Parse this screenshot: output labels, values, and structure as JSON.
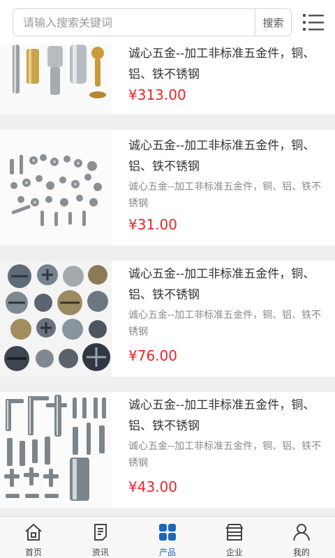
{
  "search": {
    "placeholder": "请输入搜索关键词",
    "button_label": "搜索"
  },
  "menu": {
    "icon": "list-menu-icon"
  },
  "products": [
    {
      "title": "诚心五金--加工非标准五金件，铜、铝、铁不锈钢",
      "desc": "",
      "price": "¥313.00"
    },
    {
      "title": "诚心五金--加工非标准五金件，铜、铝、铁不锈钢",
      "desc": "诚心五金--加工非标准五金件，铜、铝、铁不锈钢",
      "price": "¥31.00"
    },
    {
      "title": "诚心五金--加工非标准五金件，铜、铝、铁不锈钢",
      "desc": "诚心五金--加工非标准五金件，铜、铝、铁不锈钢",
      "price": "¥76.00"
    },
    {
      "title": "诚心五金--加工非标准五金件，铜、铝、铁不锈钢",
      "desc": "诚心五金--加工非标准五金件，铜、铝、铁不锈钢",
      "price": "¥43.00"
    }
  ],
  "tabbar": {
    "items": [
      {
        "label": "首页",
        "icon": "home-icon"
      },
      {
        "label": "资讯",
        "icon": "news-icon"
      },
      {
        "label": "产品",
        "icon": "products-grid-icon",
        "active": true
      },
      {
        "label": "企业",
        "icon": "company-icon"
      },
      {
        "label": "我的",
        "icon": "user-icon"
      }
    ]
  },
  "colors": {
    "price": "#e8262a",
    "accent": "#1a68b8",
    "background": "#efefef"
  }
}
